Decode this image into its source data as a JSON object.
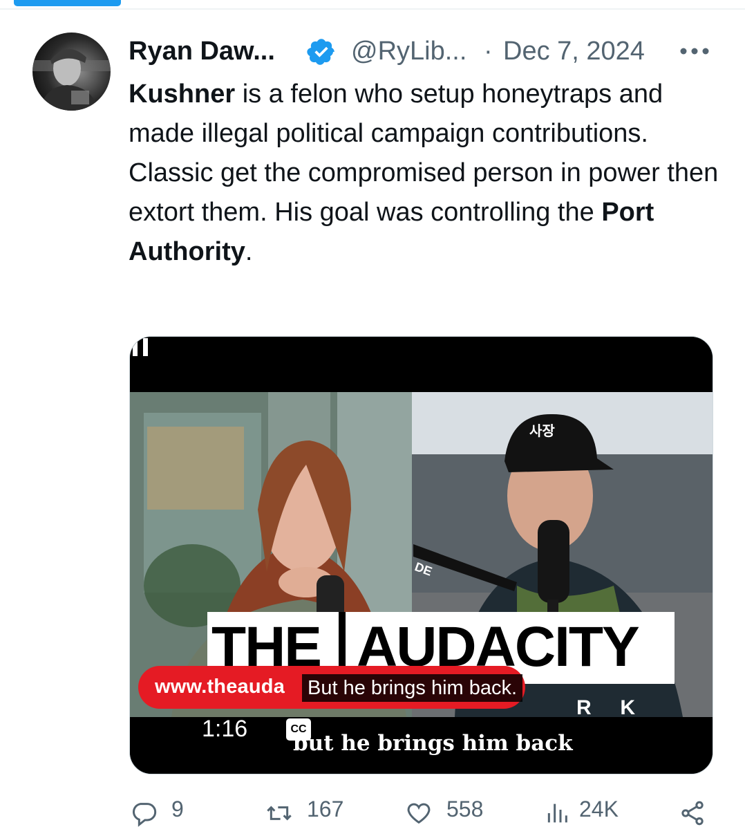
{
  "tweet": {
    "author_name": "Ryan Daw...",
    "handle": "@RyLib...",
    "separator": "·",
    "date": "Dec 7, 2024",
    "text_runs": [
      {
        "text": "Kushner",
        "bold": true
      },
      {
        "text": " is a felon who setup honeytraps and made illegal political campaign contributions.  Classic get the compromised person in power then extort them. His goal was controlling the ",
        "bold": false
      },
      {
        "text": "Port Authority",
        "bold": true
      },
      {
        "text": ".",
        "bold": false
      }
    ]
  },
  "video": {
    "hat_text": "사장",
    "mic_label": "DE",
    "banner_left": "THE",
    "banner_right": "AUDACITY",
    "network_letters": "R     K",
    "site_text": "www.theauda",
    "caption": "But he brings him back.",
    "burned_subtitle": "but he brings him back",
    "timestamp": "1:16",
    "cc_label": "CC"
  },
  "actions": {
    "replies": "9",
    "reposts": "167",
    "likes": "558",
    "views": "24K"
  },
  "colors": {
    "accent": "#1d9bf0",
    "text": "#0f1419",
    "secondary": "#536471",
    "site_pill": "#e51b24"
  },
  "icons": [
    "verified-badge-icon",
    "more-icon",
    "pause-icon",
    "cc-icon",
    "reply-icon",
    "repost-icon",
    "like-icon",
    "views-icon",
    "share-icon"
  ]
}
